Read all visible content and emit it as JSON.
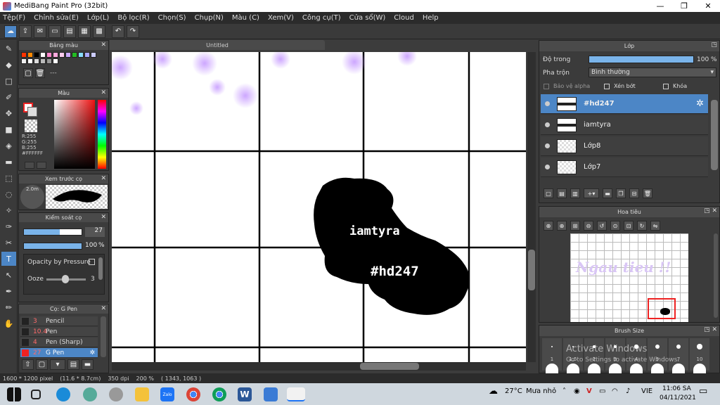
{
  "window": {
    "title": "MediBang Paint Pro (32bit)",
    "minimize": "—",
    "maximize": "❐",
    "close": "✕"
  },
  "menu": [
    "Tệp(F)",
    "Chỉnh sửa(E)",
    "Lớp(L)",
    "Bộ lọc(R)",
    "Chọn(S)",
    "Chụp(N)",
    "Màu (C)",
    "Xem(V)",
    "Công cụ(T)",
    "Cửa sổ(W)",
    "Cloud",
    "Help"
  ],
  "document": {
    "tab_title": "Untitled",
    "sticker_text_1": "iamtyra",
    "sticker_text_2": "#hd247"
  },
  "palette_panel": {
    "title": "Bảng màu",
    "colors": [
      "#ff3300",
      "#ff8800",
      "#000000",
      "#ffffff",
      "#ff88cc",
      "#ffaadd",
      "#ffccee",
      "#ccaaff",
      "#22bb22",
      "#88ddff",
      "#aaaaff",
      "#ccccff",
      "#eeeeee",
      "#ffffff",
      "#dddddd",
      "#bbbbbb",
      "#999999",
      "#ffffff"
    ],
    "name_label": "---"
  },
  "color_panel": {
    "title": "Màu",
    "r": "R:255",
    "g": "G:255",
    "b": "B:255",
    "hex": "#FFFFFF"
  },
  "brush_preview": {
    "title": "Xem trước cọ",
    "size": "2.0m"
  },
  "brush_control": {
    "title": "Kiểm soát cọ",
    "size_value": "27",
    "size_fraction": 0.62,
    "opacity_value": "100",
    "opacity_unit": "%",
    "opacity_fraction": 1.0,
    "opacity_by_pressure": "Opacity by Pressure",
    "ooze_label": "Ooze",
    "ooze_value": "3"
  },
  "brush_list": {
    "title": "Cọ: G Pen",
    "items": [
      {
        "size": "3",
        "name": "Pencil",
        "color": "#222222"
      },
      {
        "size": "10.4",
        "name": "Pen",
        "color": "#222222"
      },
      {
        "size": "4",
        "name": "Pen (Sharp)",
        "color": "#222222"
      },
      {
        "size": "27",
        "name": "G Pen",
        "color": "#ee2222"
      }
    ]
  },
  "layer_panel": {
    "title": "Lớp",
    "opacity_label": "Độ trong",
    "opacity_value": "100 %",
    "opacity_fraction": 1.0,
    "blend_label": "Pha trộn",
    "blend_value": "Bình thường",
    "protect_alpha": "Bảo vệ alpha",
    "clipping": "Xén bớt",
    "lock": "Khóa",
    "layers": [
      {
        "name": "#hd247"
      },
      {
        "name": "iamtyra"
      },
      {
        "name": "Lớp8"
      },
      {
        "name": "Lớp7"
      }
    ]
  },
  "navigator_panel": {
    "title": "Hoa tiêu",
    "preview_text": "Ngau tieu !!"
  },
  "brush_size_panel": {
    "title": "Brush Size",
    "sizes": [
      "1",
      "1.5",
      "2",
      "3",
      "4",
      "5",
      "7",
      "10"
    ],
    "watermark_line_1": "Activate Windows",
    "watermark_line_2": "Go to Settings to activate Windows."
  },
  "statusbar": {
    "pixels": "1600 * 1200 pixel",
    "physical": "(11.6 * 8.7cm)",
    "dpi": "350 dpi",
    "zoom": "200 %",
    "coords": "( 1343, 1063 )"
  },
  "taskbar": {
    "weather_temp": "27°C",
    "weather_desc": "Mưa nhỏ",
    "language": "VIE",
    "time": "11:06 SA",
    "date": "04/11/2021",
    "apps": [
      "Zalo"
    ]
  }
}
